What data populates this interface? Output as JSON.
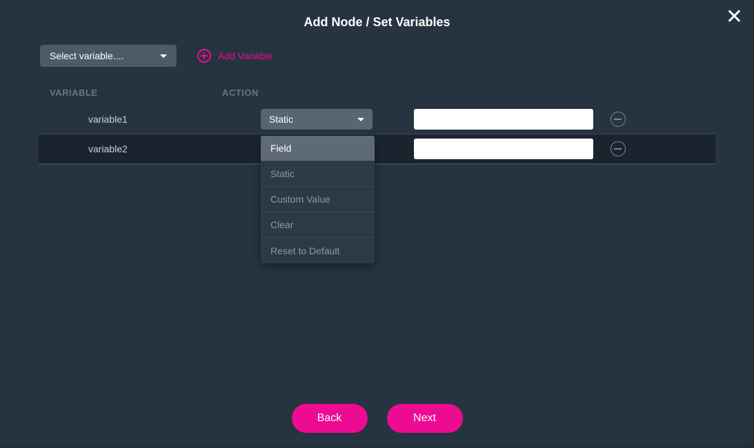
{
  "title": "Add Node / Set Variables",
  "select_variable": {
    "placeholder": "Select variable...."
  },
  "add_variable_label": "Add Variable",
  "headers": {
    "variable": "VARIABLE",
    "action": "ACTION"
  },
  "rows": [
    {
      "name": "variable1",
      "action": "Static",
      "value": "",
      "dropdown_open": false
    },
    {
      "name": "variable2",
      "action": "Field",
      "value": "",
      "dropdown_open": true
    }
  ],
  "action_options": [
    "Field",
    "Static",
    "Custom Value",
    "Clear",
    "Reset to Default"
  ],
  "buttons": {
    "back": "Back",
    "next": "Next"
  }
}
